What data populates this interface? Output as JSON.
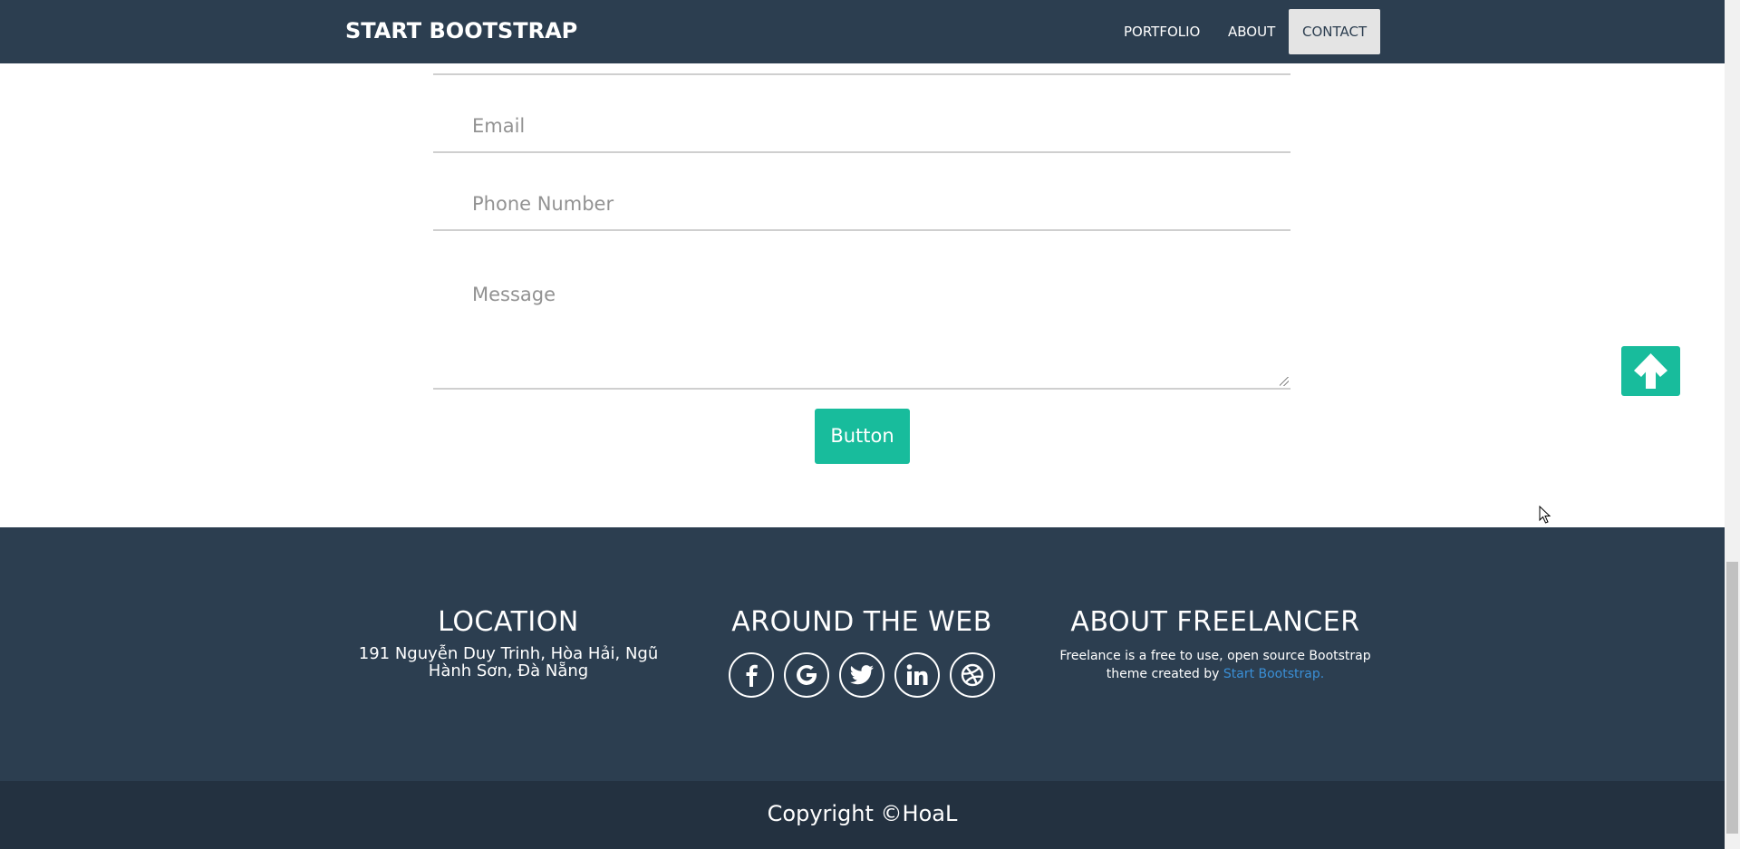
{
  "navbar": {
    "brand": "START BOOTSTRAP",
    "items": [
      {
        "label": "PORTFOLIO",
        "active": false
      },
      {
        "label": "ABOUT",
        "active": false
      },
      {
        "label": "CONTACT",
        "active": true
      }
    ]
  },
  "form": {
    "email_placeholder": "Email",
    "phone_placeholder": "Phone Number",
    "message_placeholder": "Message",
    "submit_label": "Button"
  },
  "back_to_top": {
    "icon": "arrow-up-icon"
  },
  "footer": {
    "location": {
      "title": "LOCATION",
      "address_line1": "191 Nguyễn Duy Trinh, Hòa Hải, Ngũ",
      "address_line2": "Hành Sơn, Đà Nẵng"
    },
    "around_the_web": {
      "title": "AROUND THE WEB",
      "icons": [
        "facebook-icon",
        "google-icon",
        "twitter-icon",
        "linkedin-icon",
        "dribbble-icon"
      ]
    },
    "about": {
      "title": "ABOUT FREELANCER",
      "text_line1": "Freelance is a free to use, open source Bootstrap",
      "text_line2_prefix": "theme created by ",
      "link_text": "Start Bootstrap."
    }
  },
  "copyright": "Copyright ©HoaL",
  "colors": {
    "primary_dark": "#2c3e50",
    "accent": "#18bc9c",
    "footer_bottom": "#233140",
    "link": "#3a8fd6"
  }
}
